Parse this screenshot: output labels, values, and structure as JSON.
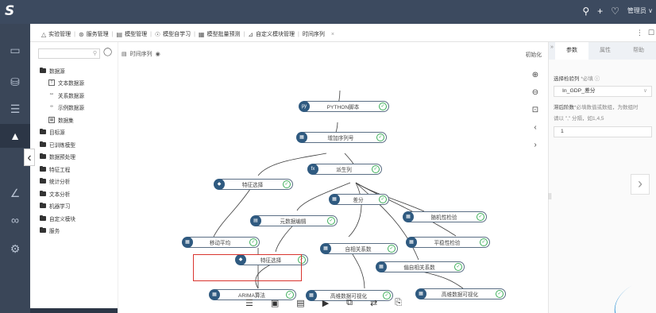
{
  "header": {
    "logo": "S",
    "icons": [
      "search-icon",
      "plus-icon",
      "bell-icon"
    ],
    "user_label": "管理员 ∨"
  },
  "tabs": [
    {
      "icon": "flask-icon",
      "label": "实验管理"
    },
    {
      "icon": "service-icon",
      "label": "服务管理"
    },
    {
      "icon": "model-icon",
      "label": "模型管理"
    },
    {
      "icon": "self-learn-icon",
      "label": "模型自学习"
    },
    {
      "icon": "batch-predict-icon",
      "label": "模型批量预测"
    },
    {
      "icon": "custom-module-icon",
      "label": "自定义模块管理"
    },
    {
      "icon": "",
      "label": "时间序列"
    }
  ],
  "tab_close": "×",
  "window_controls": [
    "⋮",
    "☐"
  ],
  "tree": {
    "search_placeholder": "",
    "items": [
      {
        "label": "数据源",
        "level": 0
      },
      {
        "label": "文本数据源",
        "level": 1,
        "icon": "T"
      },
      {
        "label": "关系数据源",
        "level": 1,
        "icon": "⚯"
      },
      {
        "label": "示例数据源",
        "level": 1,
        "icon": "∞"
      },
      {
        "label": "数据集",
        "level": 1,
        "icon": "▦"
      },
      {
        "label": "目标源",
        "level": 0
      },
      {
        "label": "已训练模型",
        "level": 0
      },
      {
        "label": "数据预处理",
        "level": 0
      },
      {
        "label": "特征工程",
        "level": 0
      },
      {
        "label": "统计分析",
        "level": 0
      },
      {
        "label": "文本分析",
        "level": 0
      },
      {
        "label": "机器学习",
        "level": 0
      },
      {
        "label": "自定义模块",
        "level": 0
      },
      {
        "label": "服务",
        "level": 0
      }
    ]
  },
  "canvas": {
    "title": "时间序列",
    "init_button": "初始化",
    "nodes": [
      {
        "label": "PYTHON脚本",
        "icon": "py"
      },
      {
        "label": "增加序列号",
        "icon": "▦"
      },
      {
        "label": "派生列",
        "icon": "fx"
      },
      {
        "label": "特征选择",
        "icon": "◆"
      },
      {
        "label": "差分",
        "icon": "▦"
      },
      {
        "label": "元数据编辑",
        "icon": "▤"
      },
      {
        "label": "随机性检验",
        "icon": "▦"
      },
      {
        "label": "移动平均",
        "icon": "▦"
      },
      {
        "label": "自相关系数",
        "icon": "▦"
      },
      {
        "label": "平稳性检验",
        "icon": "▦"
      },
      {
        "label": "特征选择",
        "icon": "◆"
      },
      {
        "label": "偏自相关系数",
        "icon": "▦"
      },
      {
        "label": "ARIMA算法",
        "icon": "▦"
      },
      {
        "label": "高维数据可视化",
        "icon": "▦"
      },
      {
        "label": "高维数据可视化",
        "icon": "▦"
      }
    ],
    "node_check": "✓",
    "zoom_tools": [
      "⊕",
      "⊖",
      "⊡",
      "‹",
      "›"
    ],
    "bottom_tools": [
      "☰",
      "▣",
      "▤",
      "▶",
      "⧉",
      "⇄",
      "⎘"
    ]
  },
  "panel": {
    "tabs": [
      "参数",
      "属性",
      "帮助"
    ],
    "field1_label": "选择检验列",
    "field1_req": "*必填 ⓘ",
    "field1_value": "In_GDP_差分",
    "field2_label": "滞后阶数",
    "field2_req": "*必填数值或数组，为数组时",
    "field2_hint": "请以 \",\" 分隔，如1,4,5",
    "field2_value": "1",
    "nav_arrow": "›"
  }
}
